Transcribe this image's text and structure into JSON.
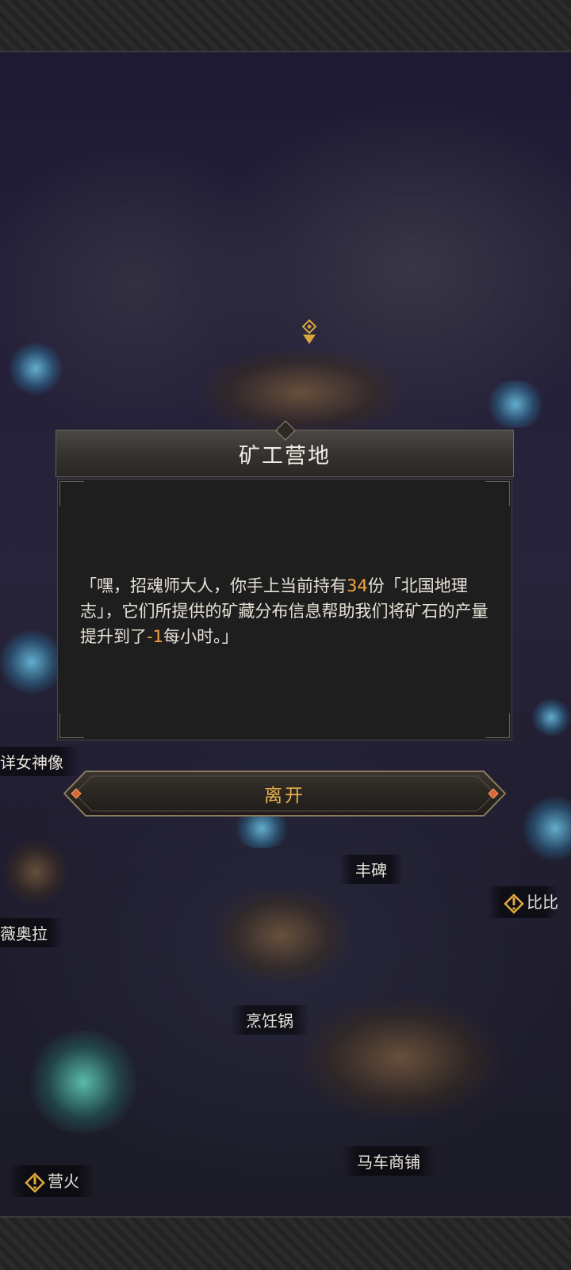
{
  "dialog": {
    "title": "矿工营地",
    "text_before_count": "「嘿，招魂师大人，你手上当前持有",
    "count": "34",
    "text_middle": "份「北国地理志」，它们所提供的矿藏分布信息帮助我们将矿石的产量提升到了",
    "rate": "-1",
    "text_after": "每小时。」"
  },
  "leave_button": {
    "label": "离开"
  },
  "map_labels": {
    "goddess_statue": "详女神像",
    "fengbei": "丰碑",
    "bibi": "比比",
    "weiaola": "薇奥拉",
    "cooking_pot": "烹饪锅",
    "carriage_shop": "马车商铺",
    "campfire": "营火"
  },
  "icons": {
    "quest_marker": "exclamation-icon",
    "location_pin": "map-pin-icon"
  },
  "colors": {
    "highlight": "#f2a640",
    "button_text": "#e9b24c"
  }
}
